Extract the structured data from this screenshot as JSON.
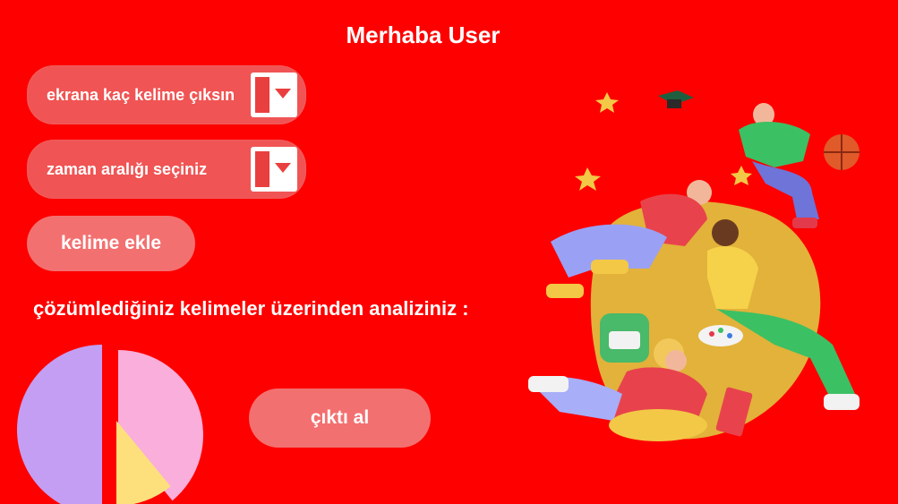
{
  "header": {
    "title": "Merhaba User"
  },
  "controls": {
    "word_count_dropdown": {
      "label": "ekrana kaç kelime çıksın"
    },
    "time_range_dropdown": {
      "label": "zaman aralığı seçiniz"
    },
    "add_word_button": "kelime ekle"
  },
  "analysis": {
    "title": "çözümlediğiniz kelimeler üzerinden analiziniz :",
    "output_button": "çıktı al"
  },
  "chart_data": {
    "type": "pie",
    "slices": [
      {
        "fraction": 0.5,
        "color": "#c39ef2"
      },
      {
        "fraction": 0.39,
        "color": "#f9aedb"
      },
      {
        "fraction": 0.11,
        "color": "#fde07c"
      }
    ]
  },
  "colors": {
    "background": "#fe0000",
    "button": "#f37070",
    "dropdown": "#f05454"
  }
}
